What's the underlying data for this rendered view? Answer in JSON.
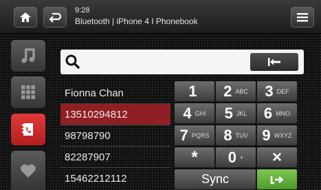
{
  "header": {
    "time": "9:28",
    "subtitle": "Bluetooth | iPhone 4 I Phonebook",
    "icons": [
      "home-icon",
      "back-icon",
      "menu-icon"
    ]
  },
  "sidebar": {
    "items": [
      {
        "name": "music",
        "icon": "music-note-icon"
      },
      {
        "name": "apps",
        "icon": "grid-icon"
      },
      {
        "name": "phone",
        "icon": "phonebook-icon",
        "active": true
      },
      {
        "name": "favorites",
        "icon": "heart-icon"
      }
    ]
  },
  "search": {
    "value": ""
  },
  "contacts": [
    "Fionna Chan",
    "13510294812",
    "98798790",
    "82287907",
    "15462212112"
  ],
  "selected_contact": "13510294812",
  "keypad": {
    "keys": [
      {
        "digit": "1",
        "letters": ""
      },
      {
        "digit": "2",
        "letters": "ABC"
      },
      {
        "digit": "3",
        "letters": "DEF"
      },
      {
        "digit": "4",
        "letters": "GHI"
      },
      {
        "digit": "5",
        "letters": "JKL"
      },
      {
        "digit": "6",
        "letters": "MNO"
      },
      {
        "digit": "7",
        "letters": "PQRS"
      },
      {
        "digit": "8",
        "letters": "TUV"
      },
      {
        "digit": "9",
        "letters": "WXYZ"
      },
      {
        "digit": "*",
        "letters": ""
      },
      {
        "digit": "0",
        "letters": "+"
      },
      {
        "digit": "×",
        "letters": ""
      }
    ],
    "sync_label": "Sync",
    "call_icon": "call-icon"
  },
  "colors": {
    "accent_red": "#c62828",
    "selected_row": "#8f1f24",
    "call_green": "#5fae3a"
  }
}
